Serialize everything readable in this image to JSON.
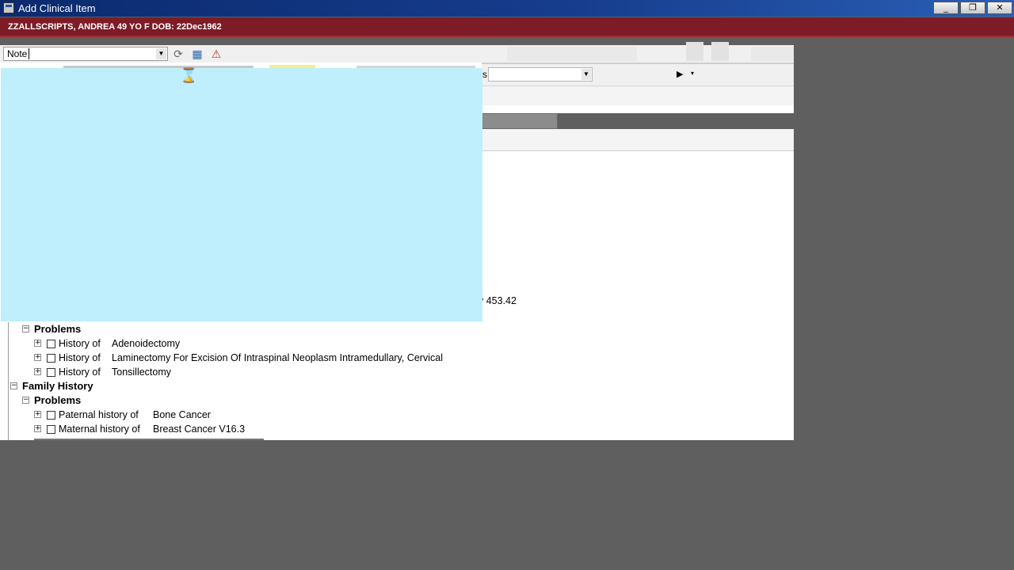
{
  "window": {
    "title": "Add Clinical Item",
    "controls": {
      "minimize": "_",
      "maximize": "❐",
      "close": "✕"
    }
  },
  "patient": {
    "banner": "ZZALLSCRIPTS, ANDREA  49 YO  F DOB: 22Dec1962"
  },
  "toolbar": {
    "note_select": {
      "value": "Note",
      "arrow": "▼"
    },
    "icons": {
      "refresh": "⟳",
      "grid": "▦",
      "alert": "⚠"
    }
  },
  "view_row": {
    "partial_label": "s",
    "select_arrow": "▼",
    "play": "▶",
    "play_dropdown": "▾"
  },
  "tree": {
    "partial_item": "y 453.42",
    "sections": [
      {
        "label": "",
        "groups": [
          {
            "label": "Problems",
            "items": [
              {
                "prefix": "History of",
                "name": "Adenoidectomy"
              },
              {
                "prefix": "History of",
                "name": "Laminectomy For Excision Of Intraspinal Neoplasm Intramedullary, Cervical"
              },
              {
                "prefix": "History of",
                "name": "Tonsillectomy"
              }
            ]
          }
        ]
      },
      {
        "label": "Family History",
        "groups": [
          {
            "label": "Problems",
            "items": [
              {
                "prefix": "Paternal history of",
                "name": "Bone Cancer"
              },
              {
                "prefix": "Maternal history of",
                "name": "Breast Cancer V16.3"
              }
            ]
          }
        ]
      }
    ],
    "expander_plus": "+",
    "expander_minus": "−"
  },
  "busy_cursor": "⌛",
  "colors": {
    "title_bar": "#163c8c",
    "patient_banner": "#7d1c26",
    "overlay": "#bfeffc",
    "desktop": "#5f5f5f"
  }
}
